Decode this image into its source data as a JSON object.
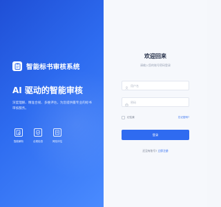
{
  "brand": {
    "name": "智能标书审核系统",
    "logo_icon": "clipboard-icon"
  },
  "hero": {
    "headline": "AI 驱动的智能审核",
    "description": "深度理解、精准合规、多维评估，为您提供最专业的标书审核服务。"
  },
  "features": [
    {
      "icon": "document-search-icon",
      "label": "智能解析"
    },
    {
      "icon": "shield-check-icon",
      "label": "合规检查"
    },
    {
      "icon": "report-icon",
      "label": "风险评估"
    }
  ],
  "login": {
    "title": "欢迎回来",
    "subtitle": "请输入您的账号密码登录",
    "username_placeholder": "用户名",
    "password_placeholder": "密码",
    "remember_label": "记住我",
    "forgot_label": "忘记密码?",
    "submit_label": "登录",
    "register_question": "还没有账号?",
    "register_link": "立即注册"
  },
  "colors": {
    "accent": "#2F6BF0",
    "panel_gradient_start": "#1F4FD6",
    "panel_gradient_end": "#4A8BFF"
  }
}
